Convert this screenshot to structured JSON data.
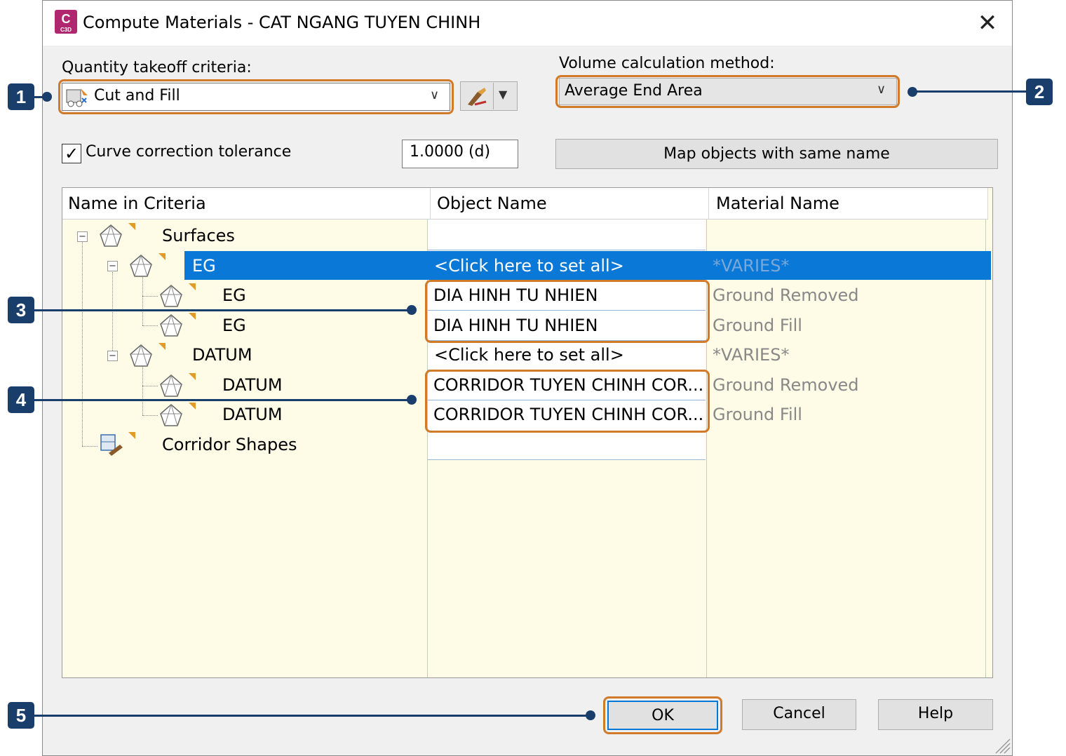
{
  "window": {
    "title": "Compute Materials - CAT NGANG TUYEN CHINH",
    "app_icon_letter": "C",
    "app_icon_caption": "C3D"
  },
  "criteria": {
    "label": "Quantity takeoff criteria:",
    "value": "Cut and Fill"
  },
  "volume": {
    "label": "Volume calculation method:",
    "value": "Average End Area"
  },
  "curve": {
    "label": "Curve correction tolerance",
    "checked": true,
    "value": "1.0000 (d)"
  },
  "map_button_label": "Map objects with same name",
  "grid": {
    "headers": [
      "Name in Criteria",
      "Object Name",
      "Material Name"
    ],
    "rows": [
      {
        "name": "Surfaces",
        "object": "",
        "material": ""
      },
      {
        "name": "EG",
        "object": "<Click here to set all>",
        "material": "*VARIES*"
      },
      {
        "name": "EG",
        "object": "DIA HINH TU NHIEN",
        "material": "Ground Removed"
      },
      {
        "name": "EG",
        "object": "DIA HINH TU NHIEN",
        "material": "Ground Fill"
      },
      {
        "name": "DATUM",
        "object": "<Click here to set all>",
        "material": "*VARIES*"
      },
      {
        "name": "DATUM",
        "object": "CORRIDOR TUYEN CHINH COR...",
        "material": "Ground Removed"
      },
      {
        "name": "DATUM",
        "object": "CORRIDOR TUYEN CHINH COR...",
        "material": "Ground Fill"
      },
      {
        "name": "Corridor Shapes",
        "object": "",
        "material": ""
      }
    ]
  },
  "buttons": {
    "ok": "OK",
    "cancel": "Cancel",
    "help": "Help"
  },
  "callouts": [
    "1",
    "2",
    "3",
    "4",
    "5"
  ],
  "colors": {
    "accent": "#0a78d7",
    "highlight": "#d07a2a",
    "callout": "#1a3e6b",
    "grid_bg": "#fefbe6"
  },
  "icons": [
    "app-icon",
    "close-icon",
    "criteria-icon",
    "chevron-down-icon",
    "pick-icon",
    "checkmark-icon",
    "surface-icon",
    "corridor-shapes-icon",
    "collapse-icon",
    "resize-grip-icon"
  ]
}
